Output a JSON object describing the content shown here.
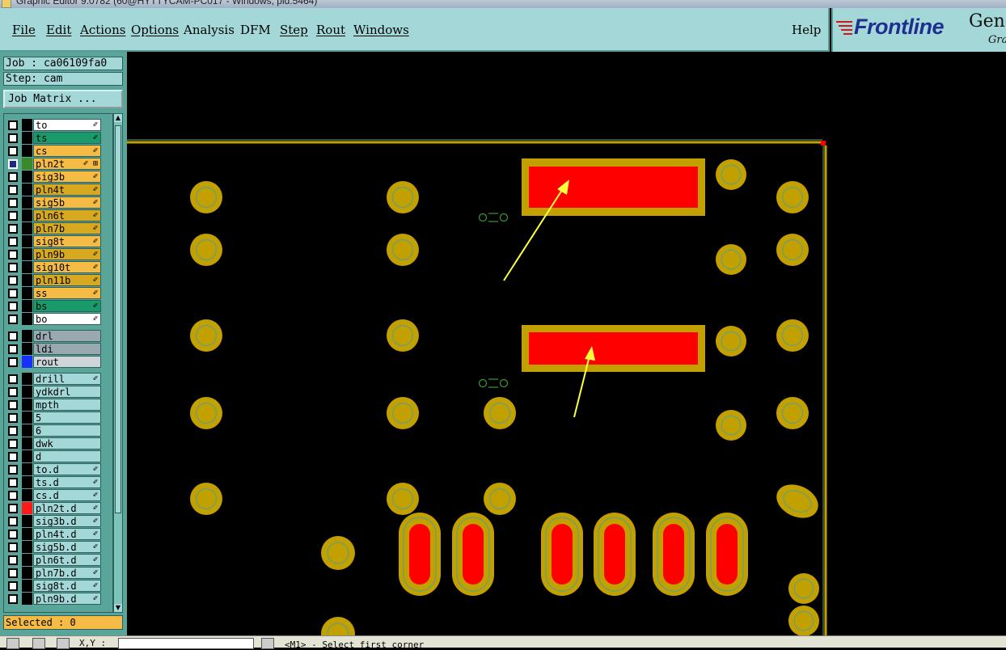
{
  "window": {
    "title": "Graphic Editor 9.0782 (60@HYTTYCAM-PC017 - Windows, pid:5464)"
  },
  "menu": {
    "items": [
      "File",
      "Edit",
      "Actions",
      "Options",
      "Analysis",
      "DFM",
      "Step",
      "Rout",
      "Windows"
    ],
    "help": "Help"
  },
  "logo": {
    "brand": "Frontline",
    "product": "Genes",
    "sub": "Grap"
  },
  "job": {
    "job_label": "Job : ca06109fa0",
    "step_label": "Step: cam",
    "matrix_button": "Job Matrix ..."
  },
  "layers": [
    {
      "name": "to",
      "color": "#ffffff",
      "flag": "✐"
    },
    {
      "name": "ts",
      "color": "#1a9a6a",
      "flag": "✐"
    },
    {
      "name": "cs",
      "color": "#f5bb45",
      "flag": "✐"
    },
    {
      "name": "pln2t",
      "color": "#f5bb45",
      "flag": "✐ ⊞",
      "swatch": "#3a8a2a",
      "checked": true
    },
    {
      "name": "sig3b",
      "color": "#f5bb45",
      "flag": "✐"
    },
    {
      "name": "pln4t",
      "color": "#d8a820",
      "flag": "✐"
    },
    {
      "name": "sig5b",
      "color": "#f5bb45",
      "flag": "✐"
    },
    {
      "name": "pln6t",
      "color": "#d8a820",
      "flag": "✐"
    },
    {
      "name": "pln7b",
      "color": "#d8a820",
      "flag": "✐"
    },
    {
      "name": "sig8t",
      "color": "#f5bb45",
      "flag": "✐"
    },
    {
      "name": "pln9b",
      "color": "#d8a820",
      "flag": "✐"
    },
    {
      "name": "sig10t",
      "color": "#f5bb45",
      "flag": "✐"
    },
    {
      "name": "pln11b",
      "color": "#d8a820",
      "flag": "✐"
    },
    {
      "name": "ss",
      "color": "#f5bb45",
      "flag": "✐"
    },
    {
      "name": "bs",
      "color": "#1a9a6a",
      "flag": "✐"
    },
    {
      "name": "bo",
      "color": "#ffffff",
      "flag": "✐"
    },
    {
      "name": "drl",
      "color": "#9aa8b0",
      "flag": ""
    },
    {
      "name": "ldi",
      "color": "#9aa8b0",
      "flag": ""
    },
    {
      "name": "rout",
      "color": "#cdd5d8",
      "flag": "",
      "swatch": "#1830ff"
    },
    {
      "name": "drill",
      "color": "#a4d8d8",
      "flag": "✐"
    },
    {
      "name": "ydkdrl",
      "color": "#a4d8d8",
      "flag": ""
    },
    {
      "name": "mpth",
      "color": "#a4d8d8",
      "flag": ""
    },
    {
      "name": "5",
      "color": "#a4d8d8",
      "flag": ""
    },
    {
      "name": "6",
      "color": "#a4d8d8",
      "flag": ""
    },
    {
      "name": "dwk",
      "color": "#a4d8d8",
      "flag": ""
    },
    {
      "name": "d",
      "color": "#a4d8d8",
      "flag": ""
    },
    {
      "name": "to.d",
      "color": "#a4d8d8",
      "flag": "✐"
    },
    {
      "name": "ts.d",
      "color": "#a4d8d8",
      "flag": "✐"
    },
    {
      "name": "cs.d",
      "color": "#a4d8d8",
      "flag": "✐"
    },
    {
      "name": "pln2t.d",
      "color": "#a4d8d8",
      "flag": "✐",
      "swatch": "#ff1a1a"
    },
    {
      "name": "sig3b.d",
      "color": "#a4d8d8",
      "flag": "✐"
    },
    {
      "name": "pln4t.d",
      "color": "#a4d8d8",
      "flag": "✐"
    },
    {
      "name": "sig5b.d",
      "color": "#a4d8d8",
      "flag": "✐"
    },
    {
      "name": "pln6t.d",
      "color": "#a4d8d8",
      "flag": "✐"
    },
    {
      "name": "pln7b.d",
      "color": "#a4d8d8",
      "flag": "✐"
    },
    {
      "name": "sig8t.d",
      "color": "#a4d8d8",
      "flag": "✐"
    },
    {
      "name": "pln9b.d",
      "color": "#a4d8d8",
      "flag": "✐"
    }
  ],
  "selected": "Selected : 0",
  "status": {
    "xy_label": "X,Y :",
    "xy_value": "",
    "prompt": "<M1> - Select first corner"
  },
  "colors": {
    "pad": "#c2a000",
    "pad_inner": "#63a07d",
    "copper_fill": "#ff0000",
    "board_outline": "#c2a000",
    "annotation_arrow": "#ffff40"
  }
}
